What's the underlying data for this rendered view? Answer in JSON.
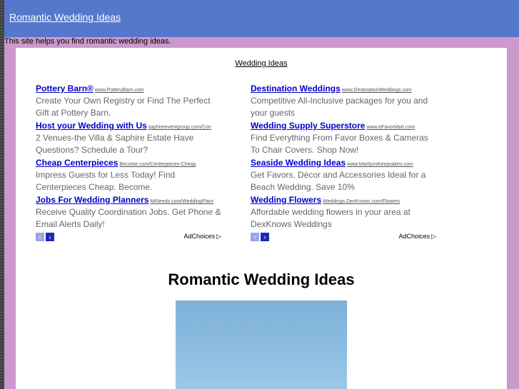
{
  "header": {
    "site_title": "Romantic Wedding Ideas"
  },
  "tagline": "This site helps you find romantic wedding ideas.",
  "content": {
    "section_title": "Wedding Ideas",
    "ads_left": [
      {
        "title": "Pottery Barn®",
        "url": "www.PotteryBarn.com",
        "desc": "Create Your Own Registry or Find The Perfect Gift at Pottery Barn."
      },
      {
        "title": "Host your Wedding with Us",
        "url": "saphireeventgroup.com/Con",
        "desc": "2 Venues-the Villa & Saphire Estate Have Questions? Schedule a Tour?"
      },
      {
        "title": "Cheap Centerpieces",
        "url": "Become.com/Centerpieces-Cheap",
        "desc": "Impress Guests for Less Today! Find Centerpieces Cheap. Become."
      },
      {
        "title": "Jobs For Wedding Planners",
        "url": "MiNeeds.com/WeddingPlanr",
        "desc": "Receive Quality Coordination Jobs. Get Phone & Email Alerts Daily!"
      }
    ],
    "ads_right": [
      {
        "title": "Destination Weddings",
        "url": "www.DestinationWeddings.com",
        "desc": "Competitive All-Inclusive packages for you and your guests"
      },
      {
        "title": "Wedding Supply Superstore",
        "url": "www.eFavorMart.com",
        "desc": "Find Everything From Favor Boxes & Cameras To Chair Covers. Shop Now!"
      },
      {
        "title": "Seaside Wedding Ideas",
        "url": "www.MarilynsKeepsakes.com",
        "desc": "Get Favors, Décor and Accessories Ideal for a Beach Wedding. Save 10%"
      },
      {
        "title": "Wedding Flowers",
        "url": "Weddings.DexKnows.com/Flowers",
        "desc": "Affordable wedding flowers in your area at DexKnows Weddings"
      }
    ],
    "ad_nav": {
      "prev": "‹",
      "next": "›",
      "adchoices_label": "AdChoices",
      "adchoices_icon": "▷"
    },
    "main_heading": "Romantic Wedding Ideas"
  },
  "colors": {
    "background": "#cc99cc",
    "header": "#5577cc",
    "link": "#0000cc"
  }
}
